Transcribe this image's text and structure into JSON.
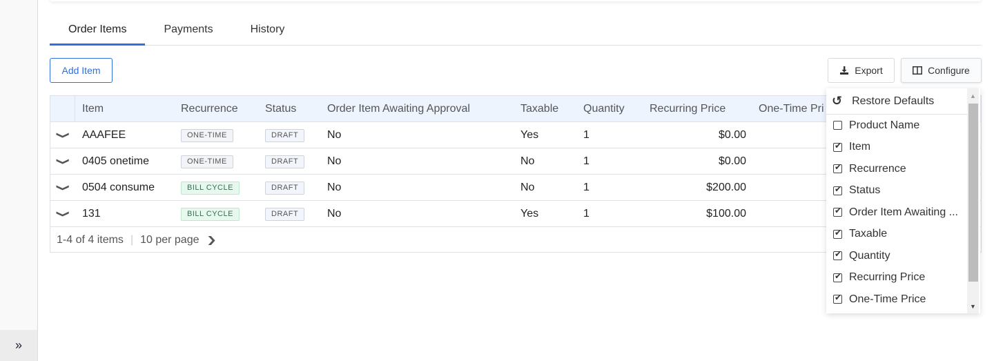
{
  "sidebar": {
    "toggle_icon": "»"
  },
  "tabs": [
    {
      "label": "Order Items",
      "active": true
    },
    {
      "label": "Payments",
      "active": false
    },
    {
      "label": "History",
      "active": false
    }
  ],
  "toolbar": {
    "add_item_label": "Add Item",
    "export_label": "Export",
    "export_icon": "download-icon",
    "configure_label": "Configure",
    "configure_icon": "columns-icon"
  },
  "table": {
    "columns": [
      "Item",
      "Recurrence",
      "Status",
      "Order Item Awaiting Approval",
      "Taxable",
      "Quantity",
      "Recurring Price",
      "One-Time Pri"
    ],
    "rows": [
      {
        "item": "AAAFEE",
        "recurrence": "ONE-TIME",
        "recurrence_type": "onetime",
        "status": "DRAFT",
        "awaiting": "No",
        "taxable": "Yes",
        "quantity": "1",
        "recurring_price": "$0.00",
        "one_time_price": ""
      },
      {
        "item": "0405 onetime",
        "recurrence": "ONE-TIME",
        "recurrence_type": "onetime",
        "status": "DRAFT",
        "awaiting": "No",
        "taxable": "No",
        "quantity": "1",
        "recurring_price": "$0.00",
        "one_time_price": "$"
      },
      {
        "item": "0504 consume",
        "recurrence": "BILL CYCLE",
        "recurrence_type": "bill",
        "status": "DRAFT",
        "awaiting": "No",
        "taxable": "No",
        "quantity": "1",
        "recurring_price": "$200.00",
        "one_time_price": ""
      },
      {
        "item": "131",
        "recurrence": "BILL CYCLE",
        "recurrence_type": "bill",
        "status": "DRAFT",
        "awaiting": "No",
        "taxable": "Yes",
        "quantity": "1",
        "recurring_price": "$100.00",
        "one_time_price": ""
      }
    ],
    "footer": {
      "range": "1-4 of 4 items",
      "per_page": "10 per page"
    }
  },
  "configure_menu": {
    "restore_label": "Restore Defaults",
    "restore_icon": "undo-icon",
    "columns": [
      {
        "label": "Product Name",
        "checked": false
      },
      {
        "label": "Item",
        "checked": true
      },
      {
        "label": "Recurrence",
        "checked": true
      },
      {
        "label": "Status",
        "checked": true
      },
      {
        "label": "Order Item Awaiting ...",
        "checked": true
      },
      {
        "label": "Taxable",
        "checked": true
      },
      {
        "label": "Quantity",
        "checked": true
      },
      {
        "label": "Recurring Price",
        "checked": true
      },
      {
        "label": "One-Time Price",
        "checked": true
      }
    ]
  },
  "colors": {
    "accent": "#2f6fe0",
    "header_bg": "#eef4fd",
    "bill_cycle_bg": "#e7f8ee"
  }
}
